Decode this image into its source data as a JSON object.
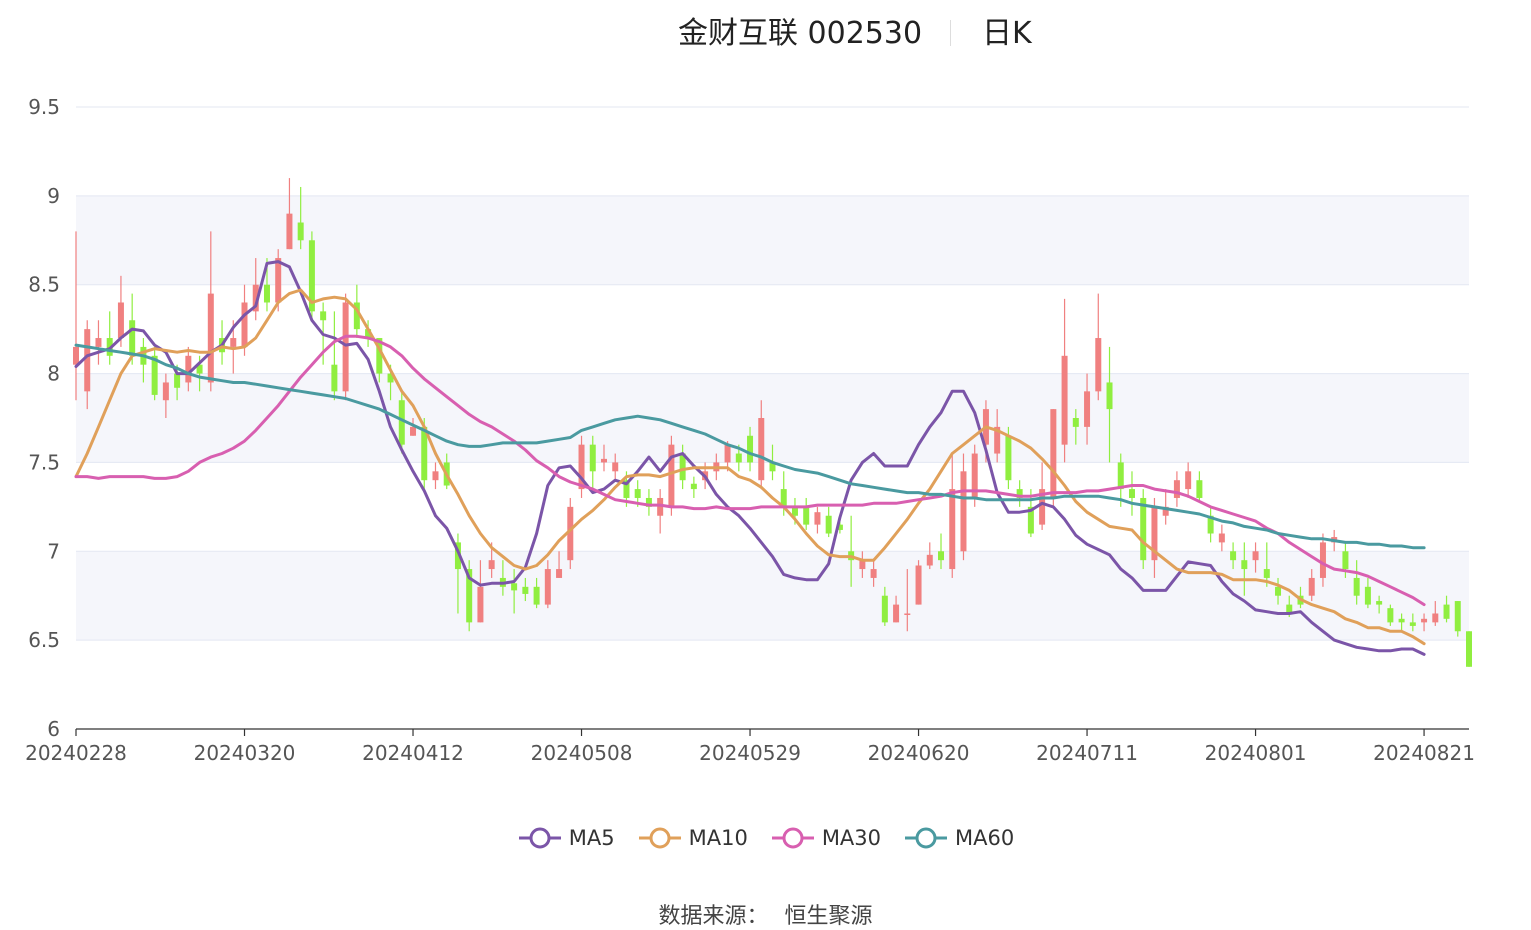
{
  "title": {
    "name": "金财互联 002530",
    "period": "日K"
  },
  "source": {
    "label": "数据来源：",
    "value": "恒生聚源"
  },
  "colors": {
    "up": "#f08080",
    "down": "#90ee40",
    "grid": "#e3e7f2",
    "band": "#f5f6fb",
    "MA5": "#7b55a8",
    "MA10": "#e0a05a",
    "MA30": "#d85fb0",
    "MA60": "#4a9aa0"
  },
  "chart_data": {
    "type": "candlestick",
    "ylim": [
      6,
      9.5
    ],
    "yticks": [
      "6",
      "6.5",
      "7",
      "7.5",
      "8",
      "8.5",
      "9",
      "9.5"
    ],
    "xticks": [
      "20240228",
      "20240320",
      "20240412",
      "20240508",
      "20240529",
      "20240620",
      "20240711",
      "20240801",
      "20240821"
    ],
    "xtick_index": [
      0,
      15,
      30,
      45,
      60,
      75,
      90,
      105,
      120
    ],
    "candles": [
      [
        8.05,
        8.15,
        8.8,
        7.85
      ],
      [
        7.9,
        8.25,
        8.3,
        7.8
      ],
      [
        8.15,
        8.2,
        8.3,
        8.05
      ],
      [
        8.2,
        8.1,
        8.35,
        8.05
      ],
      [
        8.2,
        8.4,
        8.55,
        8.15
      ],
      [
        8.3,
        8.1,
        8.45,
        8.05
      ],
      [
        8.15,
        8.05,
        8.2,
        7.95
      ],
      [
        8.1,
        7.88,
        8.15,
        7.85
      ],
      [
        7.85,
        7.95,
        8.0,
        7.75
      ],
      [
        8.0,
        7.92,
        8.05,
        7.85
      ],
      [
        7.95,
        8.1,
        8.15,
        7.9
      ],
      [
        8.05,
        8.0,
        8.1,
        7.9
      ],
      [
        7.95,
        8.45,
        8.8,
        7.9
      ],
      [
        8.2,
        8.12,
        8.3,
        8.05
      ],
      [
        8.15,
        8.2,
        8.3,
        8.0
      ],
      [
        8.15,
        8.4,
        8.5,
        8.1
      ],
      [
        8.35,
        8.5,
        8.65,
        8.3
      ],
      [
        8.5,
        8.4,
        8.65,
        8.35
      ],
      [
        8.4,
        8.65,
        8.7,
        8.35
      ],
      [
        8.7,
        8.9,
        9.1,
        8.7
      ],
      [
        8.85,
        8.75,
        9.05,
        8.7
      ],
      [
        8.75,
        8.35,
        8.8,
        8.3
      ],
      [
        8.35,
        8.3,
        8.4,
        8.05
      ],
      [
        8.05,
        7.9,
        8.35,
        7.85
      ],
      [
        7.9,
        8.4,
        8.45,
        7.85
      ],
      [
        8.4,
        8.25,
        8.5,
        8.2
      ],
      [
        8.25,
        8.2,
        8.3,
        8.15
      ],
      [
        8.2,
        8.0,
        8.2,
        7.95
      ],
      [
        8.0,
        7.95,
        8.05,
        7.85
      ],
      [
        7.85,
        7.6,
        7.9,
        7.55
      ],
      [
        7.65,
        7.7,
        7.75,
        7.65
      ],
      [
        7.7,
        7.4,
        7.75,
        7.35
      ],
      [
        7.4,
        7.45,
        7.5,
        7.35
      ],
      [
        7.5,
        7.37,
        7.55,
        7.35
      ],
      [
        7.05,
        6.9,
        7.1,
        6.65
      ],
      [
        6.9,
        6.6,
        6.95,
        6.55
      ],
      [
        6.6,
        6.8,
        6.95,
        6.6
      ],
      [
        6.9,
        6.95,
        7.05,
        6.85
      ],
      [
        6.85,
        6.8,
        6.95,
        6.75
      ],
      [
        6.82,
        6.78,
        6.9,
        6.65
      ],
      [
        6.8,
        6.76,
        6.85,
        6.72
      ],
      [
        6.8,
        6.7,
        6.85,
        6.68
      ],
      [
        6.7,
        6.9,
        6.95,
        6.68
      ],
      [
        6.85,
        6.9,
        7.0,
        6.85
      ],
      [
        6.95,
        7.25,
        7.3,
        6.9
      ],
      [
        7.35,
        7.6,
        7.65,
        7.3
      ],
      [
        7.6,
        7.45,
        7.65,
        7.35
      ],
      [
        7.5,
        7.52,
        7.6,
        7.45
      ],
      [
        7.45,
        7.5,
        7.55,
        7.4
      ],
      [
        7.4,
        7.3,
        7.45,
        7.25
      ],
      [
        7.35,
        7.3,
        7.4,
        7.25
      ],
      [
        7.3,
        7.25,
        7.35,
        7.2
      ],
      [
        7.2,
        7.3,
        7.35,
        7.1
      ],
      [
        7.25,
        7.6,
        7.65,
        7.2
      ],
      [
        7.55,
        7.4,
        7.6,
        7.35
      ],
      [
        7.38,
        7.35,
        7.42,
        7.3
      ],
      [
        7.4,
        7.45,
        7.5,
        7.35
      ],
      [
        7.45,
        7.5,
        7.55,
        7.4
      ],
      [
        7.5,
        7.6,
        7.62,
        7.45
      ],
      [
        7.55,
        7.5,
        7.6,
        7.45
      ],
      [
        7.65,
        7.5,
        7.7,
        7.45
      ],
      [
        7.4,
        7.75,
        7.85,
        7.35
      ],
      [
        7.5,
        7.45,
        7.6,
        7.4
      ],
      [
        7.35,
        7.25,
        7.45,
        7.2
      ],
      [
        7.25,
        7.2,
        7.3,
        7.15
      ],
      [
        7.25,
        7.15,
        7.3,
        7.12
      ],
      [
        7.15,
        7.22,
        7.25,
        7.1
      ],
      [
        7.2,
        7.1,
        7.25,
        7.08
      ],
      [
        7.15,
        7.12,
        7.2,
        7.1
      ],
      [
        7.0,
        6.95,
        7.2,
        6.8
      ],
      [
        6.9,
        6.95,
        7.0,
        6.85
      ],
      [
        6.85,
        6.9,
        6.95,
        6.8
      ],
      [
        6.75,
        6.6,
        6.8,
        6.58
      ],
      [
        6.6,
        6.7,
        6.75,
        6.6
      ],
      [
        6.65,
        6.65,
        6.9,
        6.55
      ],
      [
        6.7,
        6.92,
        6.95,
        6.7
      ],
      [
        6.92,
        6.98,
        7.05,
        6.9
      ],
      [
        7.0,
        6.95,
        7.1,
        6.9
      ],
      [
        6.9,
        7.35,
        7.55,
        6.85
      ],
      [
        7.0,
        7.45,
        7.55,
        6.95
      ],
      [
        7.3,
        7.55,
        7.6,
        7.25
      ],
      [
        7.6,
        7.8,
        7.85,
        7.5
      ],
      [
        7.55,
        7.7,
        7.8,
        7.5
      ],
      [
        7.65,
        7.4,
        7.7,
        7.35
      ],
      [
        7.35,
        7.3,
        7.4,
        7.25
      ],
      [
        7.25,
        7.1,
        7.35,
        7.08
      ],
      [
        7.15,
        7.35,
        7.5,
        7.12
      ],
      [
        7.3,
        7.8,
        7.8,
        7.25
      ],
      [
        7.6,
        8.1,
        8.42,
        7.5
      ],
      [
        7.75,
        7.7,
        7.8,
        7.6
      ],
      [
        7.7,
        7.9,
        8.0,
        7.6
      ],
      [
        7.9,
        8.2,
        8.45,
        7.85
      ],
      [
        7.95,
        7.8,
        8.15,
        7.5
      ],
      [
        7.5,
        7.35,
        7.55,
        7.25
      ],
      [
        7.35,
        7.3,
        7.45,
        7.2
      ],
      [
        7.3,
        6.95,
        7.35,
        6.9
      ],
      [
        6.95,
        7.25,
        7.3,
        6.85
      ],
      [
        7.2,
        7.25,
        7.35,
        7.15
      ],
      [
        7.3,
        7.4,
        7.45,
        7.25
      ],
      [
        7.35,
        7.45,
        7.5,
        7.3
      ],
      [
        7.4,
        7.3,
        7.45,
        7.28
      ],
      [
        7.2,
        7.1,
        7.25,
        7.05
      ],
      [
        7.05,
        7.1,
        7.15,
        7.0
      ],
      [
        7.0,
        6.95,
        7.05,
        6.9
      ],
      [
        6.95,
        6.9,
        7.05,
        6.75
      ],
      [
        6.95,
        7.0,
        7.05,
        6.88
      ],
      [
        6.9,
        6.85,
        7.05,
        6.8
      ],
      [
        6.8,
        6.75,
        6.85,
        6.7
      ],
      [
        6.7,
        6.65,
        6.75,
        6.63
      ],
      [
        6.75,
        6.7,
        6.8,
        6.68
      ],
      [
        6.75,
        6.85,
        6.9,
        6.72
      ],
      [
        6.85,
        7.05,
        7.1,
        6.8
      ],
      [
        7.05,
        7.08,
        7.12,
        7.0
      ],
      [
        7.0,
        6.9,
        7.05,
        6.85
      ],
      [
        6.85,
        6.75,
        6.95,
        6.7
      ],
      [
        6.8,
        6.7,
        6.85,
        6.68
      ],
      [
        6.72,
        6.7,
        6.75,
        6.65
      ],
      [
        6.68,
        6.6,
        6.7,
        6.58
      ],
      [
        6.62,
        6.6,
        6.65,
        6.55
      ],
      [
        6.6,
        6.58,
        6.65,
        6.55
      ],
      [
        6.6,
        6.62,
        6.65,
        6.55
      ],
      [
        6.6,
        6.65,
        6.72,
        6.58
      ],
      [
        6.7,
        6.62,
        6.75,
        6.6
      ],
      [
        6.72,
        6.55,
        6.72,
        6.52
      ],
      [
        6.55,
        6.35,
        6.55,
        6.35
      ]
    ],
    "series": [
      {
        "name": "MA5",
        "values": [
          8.04,
          8.1,
          8.12,
          8.14,
          8.2,
          8.25,
          8.24,
          8.16,
          8.12,
          8.0,
          8.0,
          8.06,
          8.12,
          8.16,
          8.26,
          8.33,
          8.38,
          8.62,
          8.63,
          8.6,
          8.46,
          8.3,
          8.22,
          8.2,
          8.16,
          8.17,
          8.08,
          7.9,
          7.7,
          7.57,
          7.45,
          7.34,
          7.2,
          7.13,
          7.0,
          6.85,
          6.81,
          6.82,
          6.82,
          6.83,
          6.91,
          7.1,
          7.37,
          7.47,
          7.48,
          7.41,
          7.33,
          7.35,
          7.4,
          7.38,
          7.45,
          7.53,
          7.45,
          7.53,
          7.55,
          7.48,
          7.42,
          7.32,
          7.25,
          7.2,
          7.13,
          7.05,
          6.97,
          6.87,
          6.85,
          6.84,
          6.84,
          6.93,
          7.19,
          7.4,
          7.5,
          7.55,
          7.48,
          7.48,
          7.48,
          7.6,
          7.7,
          7.78,
          7.9,
          7.9,
          7.78,
          7.57,
          7.33,
          7.22,
          7.22,
          7.23,
          7.27,
          7.25,
          7.18,
          7.09,
          7.04,
          7.01,
          6.98,
          6.9,
          6.85,
          6.78,
          6.78,
          6.78,
          6.86,
          6.94,
          6.93,
          6.92,
          6.83,
          6.76,
          6.72,
          6.67,
          6.66,
          6.65,
          6.65,
          6.66,
          6.6,
          6.55,
          6.5,
          6.48,
          6.46,
          6.45,
          6.44,
          6.44,
          6.45,
          6.45,
          6.42
        ]
      },
      {
        "name": "MA10",
        "values": [
          7.42,
          7.55,
          7.7,
          7.85,
          8.0,
          8.1,
          8.12,
          8.14,
          8.13,
          8.12,
          8.13,
          8.12,
          8.12,
          8.15,
          8.14,
          8.15,
          8.2,
          8.3,
          8.4,
          8.45,
          8.47,
          8.4,
          8.42,
          8.43,
          8.42,
          8.36,
          8.25,
          8.14,
          8.02,
          7.9,
          7.82,
          7.7,
          7.55,
          7.43,
          7.32,
          7.2,
          7.1,
          7.02,
          6.97,
          6.92,
          6.9,
          6.92,
          6.98,
          7.06,
          7.12,
          7.18,
          7.23,
          7.29,
          7.36,
          7.42,
          7.43,
          7.43,
          7.42,
          7.44,
          7.46,
          7.47,
          7.47,
          7.47,
          7.47,
          7.42,
          7.4,
          7.36,
          7.3,
          7.25,
          7.18,
          7.1,
          7.03,
          6.98,
          6.97,
          6.97,
          6.95,
          6.95,
          7.02,
          7.1,
          7.18,
          7.27,
          7.35,
          7.45,
          7.55,
          7.6,
          7.65,
          7.7,
          7.68,
          7.65,
          7.62,
          7.58,
          7.52,
          7.45,
          7.37,
          7.28,
          7.22,
          7.18,
          7.14,
          7.13,
          7.12,
          7.05,
          7.0,
          6.95,
          6.9,
          6.88,
          6.88,
          6.88,
          6.87,
          6.84,
          6.84,
          6.84,
          6.83,
          6.81,
          6.78,
          6.73,
          6.7,
          6.68,
          6.66,
          6.62,
          6.6,
          6.57,
          6.57,
          6.55,
          6.55,
          6.52,
          6.48
        ]
      },
      {
        "name": "MA30",
        "values": [
          7.42,
          7.42,
          7.41,
          7.42,
          7.42,
          7.42,
          7.42,
          7.41,
          7.41,
          7.42,
          7.45,
          7.5,
          7.53,
          7.55,
          7.58,
          7.62,
          7.68,
          7.75,
          7.82,
          7.9,
          7.98,
          8.05,
          8.12,
          8.18,
          8.21,
          8.21,
          8.2,
          8.18,
          8.15,
          8.1,
          8.03,
          7.97,
          7.92,
          7.87,
          7.82,
          7.77,
          7.73,
          7.7,
          7.66,
          7.62,
          7.57,
          7.51,
          7.47,
          7.42,
          7.39,
          7.37,
          7.35,
          7.32,
          7.29,
          7.28,
          7.27,
          7.26,
          7.26,
          7.25,
          7.25,
          7.24,
          7.24,
          7.25,
          7.24,
          7.24,
          7.24,
          7.25,
          7.25,
          7.25,
          7.25,
          7.25,
          7.26,
          7.26,
          7.26,
          7.26,
          7.26,
          7.27,
          7.27,
          7.27,
          7.28,
          7.29,
          7.3,
          7.31,
          7.33,
          7.34,
          7.34,
          7.34,
          7.33,
          7.32,
          7.31,
          7.31,
          7.32,
          7.33,
          7.33,
          7.33,
          7.34,
          7.34,
          7.35,
          7.36,
          7.37,
          7.37,
          7.35,
          7.34,
          7.33,
          7.31,
          7.28,
          7.25,
          7.23,
          7.21,
          7.19,
          7.17,
          7.13,
          7.1,
          7.05,
          7.01,
          6.97,
          6.93,
          6.9,
          6.89,
          6.88,
          6.86,
          6.83,
          6.8,
          6.77,
          6.74,
          6.7
        ]
      },
      {
        "name": "MA60",
        "values": [
          8.16,
          8.15,
          8.14,
          8.13,
          8.12,
          8.11,
          8.1,
          8.08,
          8.05,
          8.03,
          8.0,
          7.98,
          7.97,
          7.96,
          7.95,
          7.95,
          7.94,
          7.93,
          7.92,
          7.91,
          7.9,
          7.89,
          7.88,
          7.87,
          7.86,
          7.84,
          7.82,
          7.8,
          7.77,
          7.74,
          7.71,
          7.68,
          7.65,
          7.62,
          7.6,
          7.59,
          7.59,
          7.6,
          7.61,
          7.61,
          7.61,
          7.61,
          7.62,
          7.63,
          7.64,
          7.68,
          7.7,
          7.72,
          7.74,
          7.75,
          7.76,
          7.75,
          7.74,
          7.72,
          7.7,
          7.68,
          7.66,
          7.63,
          7.6,
          7.58,
          7.55,
          7.53,
          7.5,
          7.48,
          7.46,
          7.45,
          7.44,
          7.42,
          7.4,
          7.38,
          7.37,
          7.36,
          7.35,
          7.34,
          7.33,
          7.33,
          7.32,
          7.32,
          7.31,
          7.3,
          7.3,
          7.29,
          7.29,
          7.29,
          7.29,
          7.29,
          7.3,
          7.3,
          7.31,
          7.31,
          7.31,
          7.31,
          7.3,
          7.29,
          7.27,
          7.26,
          7.25,
          7.24,
          7.23,
          7.22,
          7.21,
          7.19,
          7.17,
          7.16,
          7.14,
          7.13,
          7.12,
          7.1,
          7.09,
          7.08,
          7.07,
          7.07,
          7.06,
          7.05,
          7.05,
          7.04,
          7.04,
          7.03,
          7.03,
          7.02,
          7.02
        ]
      }
    ]
  }
}
